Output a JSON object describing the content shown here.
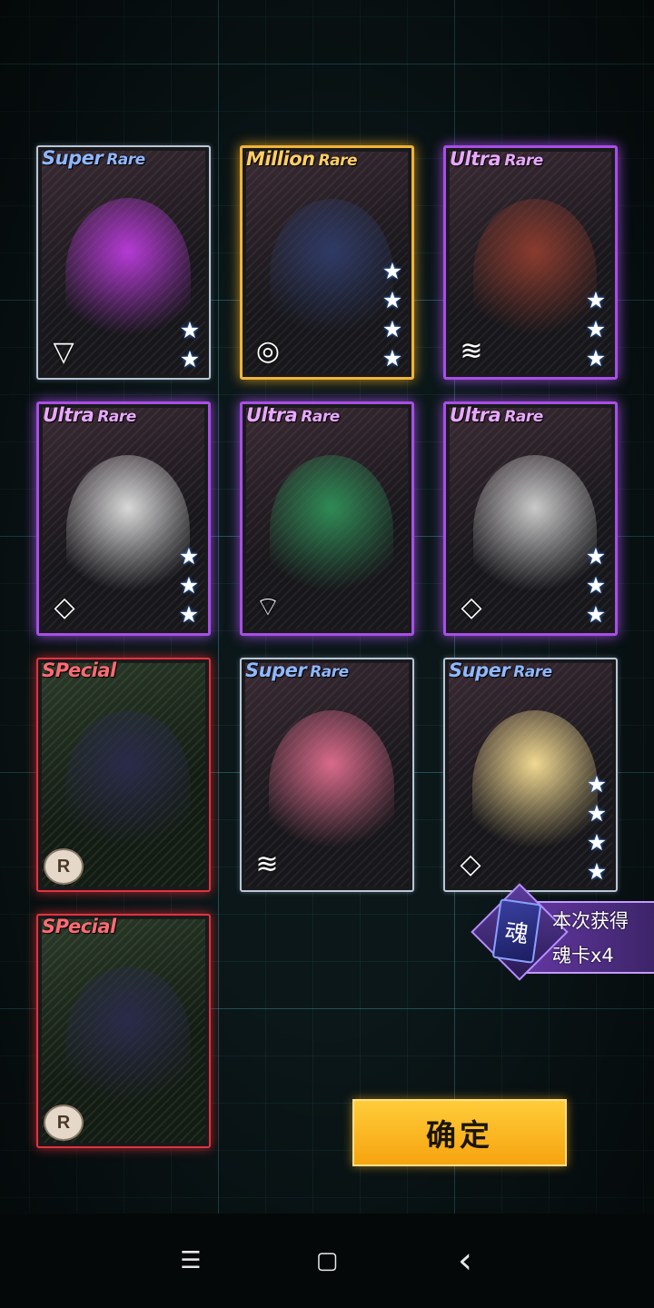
{
  "cards": [
    {
      "rarity": "Super",
      "rarity_sub": "Rare",
      "tier": "sr",
      "stars": 2,
      "type_icon": "triangle-class-icon",
      "figure_color": "#b43ad4"
    },
    {
      "rarity": "Million",
      "rarity_sub": "Rare",
      "tier": "mr",
      "stars": 4,
      "type_icon": "ring-class-icon",
      "figure_color": "#2f3b66"
    },
    {
      "rarity": "Ultra",
      "rarity_sub": "Rare",
      "tier": "ur",
      "stars": 3,
      "type_icon": "chevron-class-icon",
      "figure_color": "#8a3b2e"
    },
    {
      "rarity": "Ultra",
      "rarity_sub": "Rare",
      "tier": "ur",
      "stars": 3,
      "type_icon": "diamond-class-icon",
      "figure_color": "#d8d8d8"
    },
    {
      "rarity": "Ultra",
      "rarity_sub": "Rare",
      "tier": "ur",
      "stars": 0,
      "type_icon": "wifi-class-icon",
      "figure_color": "#2f8a55"
    },
    {
      "rarity": "Ultra",
      "rarity_sub": "Rare",
      "tier": "ur",
      "stars": 3,
      "type_icon": "diamond-class-icon",
      "figure_color": "#c9c9c9"
    },
    {
      "rarity": "SPecial",
      "rarity_sub": "",
      "tier": "sp",
      "stars": 0,
      "type_icon": "r-badge-icon",
      "badge_label": "R",
      "figure_color": "#2a2b4a"
    },
    {
      "rarity": "Super",
      "rarity_sub": "Rare",
      "tier": "sr",
      "stars": 0,
      "type_icon": "chevron-class-icon",
      "figure_color": "#d86a8a"
    },
    {
      "rarity": "Super",
      "rarity_sub": "Rare",
      "tier": "sr",
      "stars": 4,
      "type_icon": "diamond-class-icon",
      "figure_color": "#f0d890"
    },
    {
      "rarity": "SPecial",
      "rarity_sub": "",
      "tier": "sp",
      "stars": 0,
      "type_icon": "r-badge-icon",
      "badge_label": "R",
      "figure_color": "#2a2b4a"
    }
  ],
  "soul_reward": {
    "card_glyph": "魂",
    "title": "本次获得",
    "count": "魂卡x4"
  },
  "confirm_button": {
    "label": "确定"
  },
  "navbar": {
    "menu": "☰",
    "home": "▢",
    "back": "‹"
  }
}
